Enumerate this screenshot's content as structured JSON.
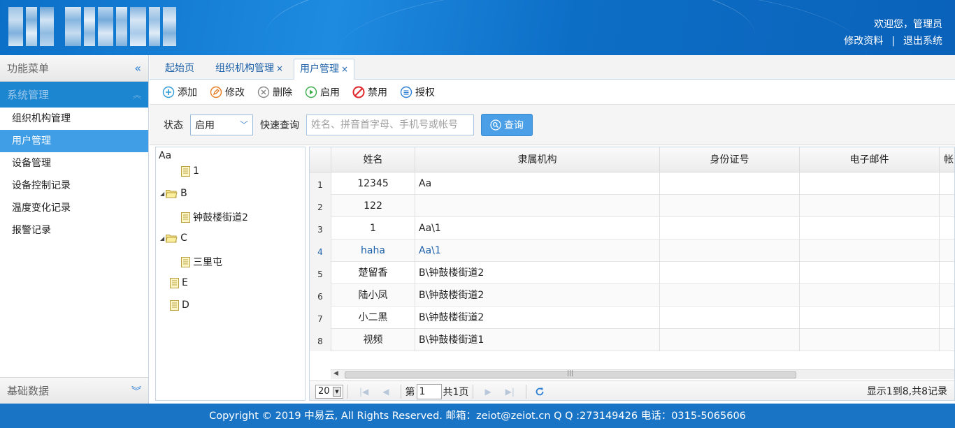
{
  "header": {
    "welcome": "欢迎您，管理员",
    "edit_profile": "修改资料",
    "separator": "|",
    "logout": "退出系统"
  },
  "sidebar": {
    "title": "功能菜单",
    "group": "系统管理",
    "items": [
      "组织机构管理",
      "用户管理",
      "设备管理",
      "设备控制记录",
      "温度变化记录",
      "报警记录"
    ],
    "active_index": 1,
    "bottom_group": "基础数据"
  },
  "tabs": [
    {
      "label": "起始页",
      "closable": false
    },
    {
      "label": "组织机构管理",
      "closable": true
    },
    {
      "label": "用户管理",
      "closable": true
    }
  ],
  "tab_close": "×",
  "toolbar": {
    "add": "添加",
    "edit": "修改",
    "delete": "删除",
    "enable": "启用",
    "disable": "禁用",
    "authorize": "授权"
  },
  "search": {
    "status_label": "状态",
    "status_value": "启用",
    "quick_label": "快速查询",
    "placeholder": "姓名、拼音首字母、手机号或帐号",
    "query_button": "查询"
  },
  "tree": {
    "root": "Aa",
    "root_child": "1",
    "b": "B",
    "b_child": "钟鼓楼街道2",
    "c": "C",
    "c_child": "三里屯",
    "e": "E",
    "d": "D"
  },
  "grid": {
    "columns": [
      "姓名",
      "隶属机构",
      "身份证号",
      "电子邮件",
      "帐"
    ],
    "rows": [
      {
        "no": "1",
        "name": "12345",
        "org": "Aa"
      },
      {
        "no": "2",
        "name": "122",
        "org": ""
      },
      {
        "no": "3",
        "name": "1",
        "org": "Aa\\1"
      },
      {
        "no": "4",
        "name": "haha",
        "org": "Aa\\1"
      },
      {
        "no": "5",
        "name": "楚留香",
        "org": "B\\钟鼓楼街道2"
      },
      {
        "no": "6",
        "name": "陆小凤",
        "org": "B\\钟鼓楼街道2"
      },
      {
        "no": "7",
        "name": "小二黑",
        "org": "B\\钟鼓楼街道2"
      },
      {
        "no": "8",
        "name": "视频",
        "org": "B\\钟鼓楼街道1"
      }
    ],
    "highlight_row": 3
  },
  "pager": {
    "page_size": "20",
    "page_prefix": "第",
    "page_value": "1",
    "page_total": "共1页",
    "info": "显示1到8,共8记录"
  },
  "footer": {
    "text": "Copyright © 2019 中易云, All Rights Reserved. 邮箱：zeiot@zeiot.cn Q Q :273149426 电话：0315-5065606"
  },
  "colors": {
    "header_blue": "#1e8be0",
    "active_item": "#3f9ee6",
    "link_blue": "#1a5fa8",
    "footer_blue": "#1a74c6"
  }
}
